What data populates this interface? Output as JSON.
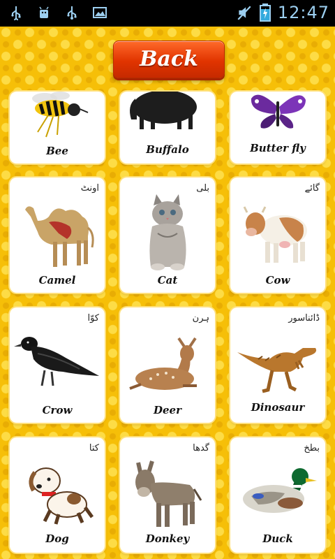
{
  "status_bar": {
    "time": "12:47",
    "left_icons": [
      "usb-icon",
      "android-debug-icon",
      "usb-icon",
      "image-icon"
    ],
    "right_icons": [
      "mute-icon",
      "battery-charging-icon"
    ]
  },
  "header": {
    "back_label": "Back"
  },
  "animals": [
    {
      "name": "Bee",
      "urdu": ""
    },
    {
      "name": "Buffalo",
      "urdu": ""
    },
    {
      "name": "Butter fly",
      "urdu": ""
    },
    {
      "name": "Camel",
      "urdu": "اونٹ"
    },
    {
      "name": "Cat",
      "urdu": "بلی"
    },
    {
      "name": "Cow",
      "urdu": "گائے"
    },
    {
      "name": "Crow",
      "urdu": "کوّا"
    },
    {
      "name": "Deer",
      "urdu": "ہرن"
    },
    {
      "name": "Dinosaur",
      "urdu": "ڈائناسور"
    },
    {
      "name": "Dog",
      "urdu": "کتا"
    },
    {
      "name": "Donkey",
      "urdu": "گدھا"
    },
    {
      "name": "Duck",
      "urdu": "بطخ"
    }
  ],
  "colors": {
    "background": "#f6bf08",
    "button": "#e13400",
    "status_bar": "#000000"
  }
}
